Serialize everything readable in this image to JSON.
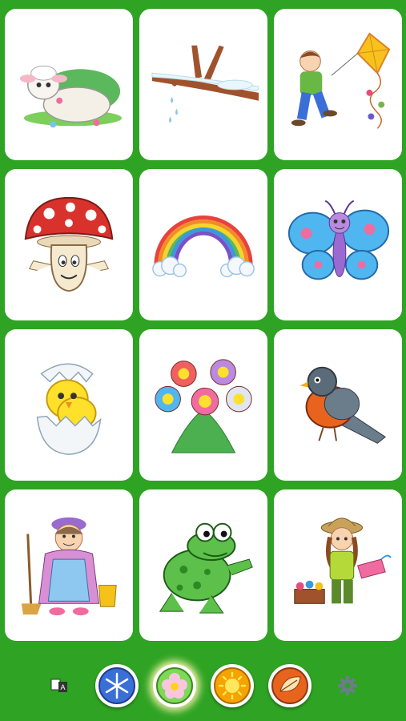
{
  "cards": [
    {
      "name": "lamb-picture"
    },
    {
      "name": "snowy-branch-picture"
    },
    {
      "name": "boy-with-kite-picture"
    },
    {
      "name": "mushroom-picture"
    },
    {
      "name": "rainbow-picture"
    },
    {
      "name": "butterfly-picture"
    },
    {
      "name": "hatching-chick-picture"
    },
    {
      "name": "flowers-picture"
    },
    {
      "name": "robin-bird-picture"
    },
    {
      "name": "grandma-with-broom-picture"
    },
    {
      "name": "frog-picture"
    },
    {
      "name": "girl-gardening-picture"
    }
  ],
  "toolbar": {
    "language_icon": "language-icon",
    "seasons": [
      {
        "name": "winter",
        "icon": "snowflake-icon",
        "color": "#3a6fd8"
      },
      {
        "name": "spring",
        "icon": "flower-icon",
        "color": "#7ed957",
        "selected": true
      },
      {
        "name": "summer",
        "icon": "sun-icon",
        "color": "#f5a300"
      },
      {
        "name": "autumn",
        "icon": "leaf-icon",
        "color": "#e8641e"
      }
    ],
    "settings_icon": "gear-icon"
  },
  "colors": {
    "background": "#2fa323",
    "card": "#ffffff"
  }
}
